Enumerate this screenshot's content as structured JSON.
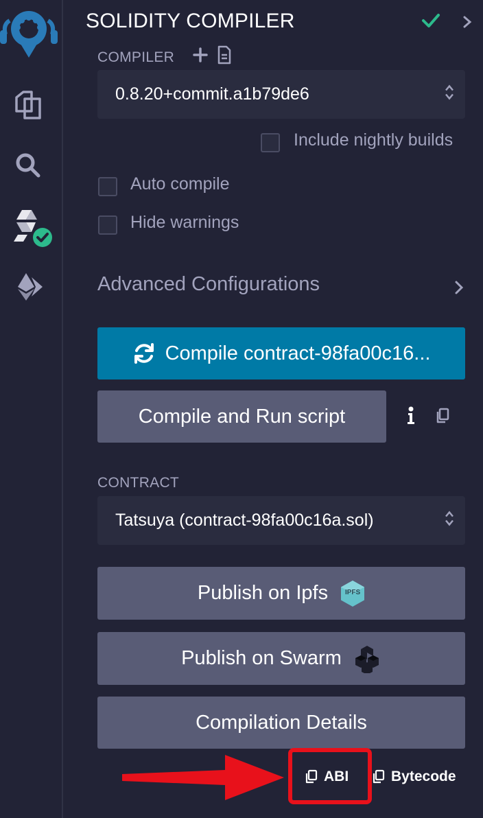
{
  "header": {
    "title": "SOLIDITY COMPILER"
  },
  "compiler": {
    "label": "COMPILER",
    "version": "0.8.20+commit.a1b79de6",
    "include_nightly_label": "Include nightly builds",
    "auto_compile_label": "Auto compile",
    "hide_warnings_label": "Hide warnings"
  },
  "advanced": {
    "label": "Advanced Configurations"
  },
  "actions": {
    "compile_label": "Compile contract-98fa00c16...",
    "compile_run_label": "Compile and Run script"
  },
  "contract": {
    "label": "CONTRACT",
    "selected": "Tatsuya (contract-98fa00c16a.sol)"
  },
  "publish": {
    "ipfs_label": "Publish on Ipfs",
    "ipfs_badge": "IPFS",
    "swarm_label": "Publish on Swarm",
    "details_label": "Compilation Details"
  },
  "copy": {
    "abi_label": "ABI",
    "bytecode_label": "Bytecode"
  },
  "colors": {
    "background": "#222336",
    "primary": "#007aa6",
    "secondary": "#595c76",
    "success": "#2dba8c",
    "annotation": "#e8111b"
  }
}
